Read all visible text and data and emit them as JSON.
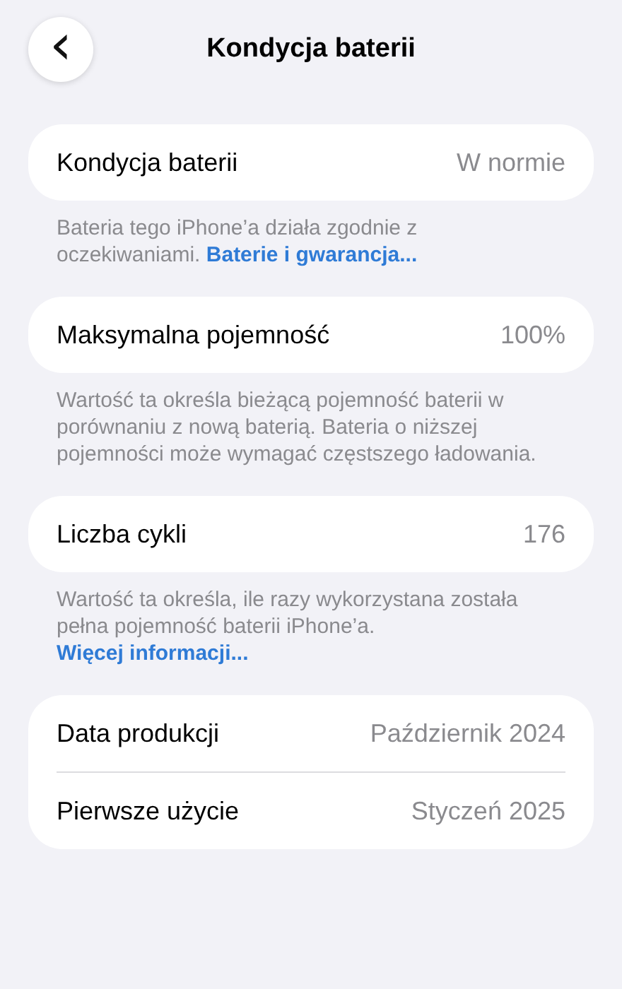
{
  "header": {
    "back": "‹",
    "title": "Kondycja baterii"
  },
  "sections": [
    {
      "rows": [
        {
          "label": "Kondycja baterii",
          "value": "W normie"
        }
      ],
      "footer": {
        "text": "Bateria tego iPhone’a działa zgodnie z oczekiwaniami.",
        "link": "Baterie i gwarancja..."
      }
    },
    {
      "rows": [
        {
          "label": "Maksymalna pojemność",
          "value": "100%"
        }
      ],
      "footer": {
        "text": "Wartość ta określa bieżącą pojemność baterii w porównaniu z nową baterią. Bateria o niższej pojemności może wymagać częstszego ładowania."
      }
    },
    {
      "rows": [
        {
          "label": "Liczba cykli",
          "value": "176"
        }
      ],
      "footer": {
        "text": "Wartość ta określa, ile razy wykorzystana została pełna pojemność baterii iPhone’a.",
        "link": "Więcej informacji..."
      }
    },
    {
      "rows": [
        {
          "label": "Data produkcji",
          "value": "Październik 2024"
        },
        {
          "label": "Pierwsze użycie",
          "value": "Styczeń 2025"
        }
      ]
    }
  ]
}
